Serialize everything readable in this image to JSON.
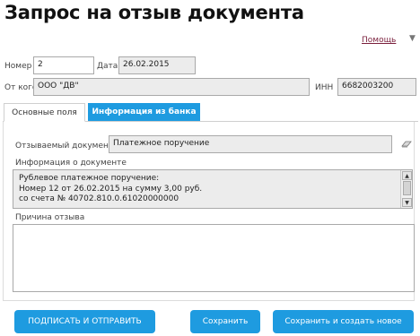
{
  "page": {
    "title": "Запрос на отзыв документа",
    "help_label": "Помощь"
  },
  "header": {
    "number_label": "Номер",
    "number_value": "2",
    "date_label": "Дата",
    "date_value": "26.02.2015",
    "from_label": "От кого",
    "from_value": "ООО \"ДВ\"",
    "inn_label": "ИНН",
    "inn_value": "6682003200"
  },
  "tabs": [
    {
      "label": "Основные поля",
      "active": true
    },
    {
      "label": "Информация из банка",
      "active": false
    }
  ],
  "form": {
    "recalled_doc_label": "Отзываемый документ",
    "recalled_doc_value": "Платежное поручение",
    "doc_info_label": "Информация о документе",
    "doc_info_lines": [
      "Рублевое платежное поручение:",
      "Номер 12 от 26.02.2015 на сумму 3,00 руб.",
      "со счета № 40702.810.0.61020000000"
    ],
    "reason_label": "Причина отзыва",
    "reason_value": ""
  },
  "buttons": {
    "sign_send": "ПОДПИСАТЬ И ОТПРАВИТЬ",
    "save": "Сохранить",
    "save_new": "Сохранить и создать новое"
  },
  "colors": {
    "accent": "#1e9be0",
    "help_link": "#7a1f3c",
    "field_readonly_bg": "#ececec"
  },
  "icons": [
    "dropdown-arrow-icon",
    "eraser-icon",
    "scroll-up-icon",
    "scroll-down-icon"
  ]
}
